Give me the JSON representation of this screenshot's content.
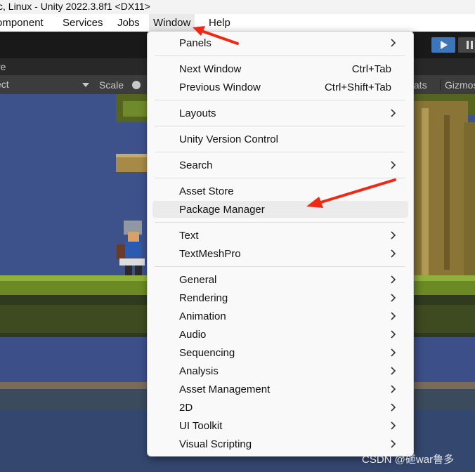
{
  "window": {
    "title": "c, Linux - Unity 2022.3.8f1 <DX11>"
  },
  "menubar": {
    "items": [
      "omponent",
      "Services",
      "Jobs",
      "Window",
      "Help"
    ],
    "active": "Window"
  },
  "game_view": {
    "tab_label": "re",
    "aspect_label": "ect",
    "scale_label": "Scale",
    "stats_label": "tats",
    "gizmos_label": "Gizmos"
  },
  "window_menu": {
    "items": [
      {
        "label": "Panels",
        "submenu": true
      },
      {
        "label": "Next Window",
        "shortcut": "Ctrl+Tab"
      },
      {
        "label": "Previous Window",
        "shortcut": "Ctrl+Shift+Tab"
      },
      {
        "label": "Layouts",
        "submenu": true
      },
      {
        "label": "Unity Version Control"
      },
      {
        "label": "Search",
        "submenu": true
      },
      {
        "label": "Asset Store"
      },
      {
        "label": "Package Manager",
        "highlighted": true
      },
      {
        "label": "Text",
        "submenu": true
      },
      {
        "label": "TextMeshPro",
        "submenu": true
      },
      {
        "label": "General",
        "submenu": true
      },
      {
        "label": "Rendering",
        "submenu": true
      },
      {
        "label": "Animation",
        "submenu": true
      },
      {
        "label": "Audio",
        "submenu": true
      },
      {
        "label": "Sequencing",
        "submenu": true
      },
      {
        "label": "Analysis",
        "submenu": true
      },
      {
        "label": "Asset Management",
        "submenu": true
      },
      {
        "label": "2D",
        "submenu": true
      },
      {
        "label": "UI Toolkit",
        "submenu": true
      },
      {
        "label": "Visual Scripting",
        "submenu": true
      }
    ]
  },
  "colors": {
    "highlight": "#ebebeb",
    "annotation_arrow": "#ee2a17",
    "play_button": "#3d76b8"
  },
  "icons": {
    "submenu": "chevron-right-icon",
    "play": "play-icon",
    "pause": "pause-icon"
  },
  "watermark": {
    "text": "CSDN @砸war鲁多"
  }
}
